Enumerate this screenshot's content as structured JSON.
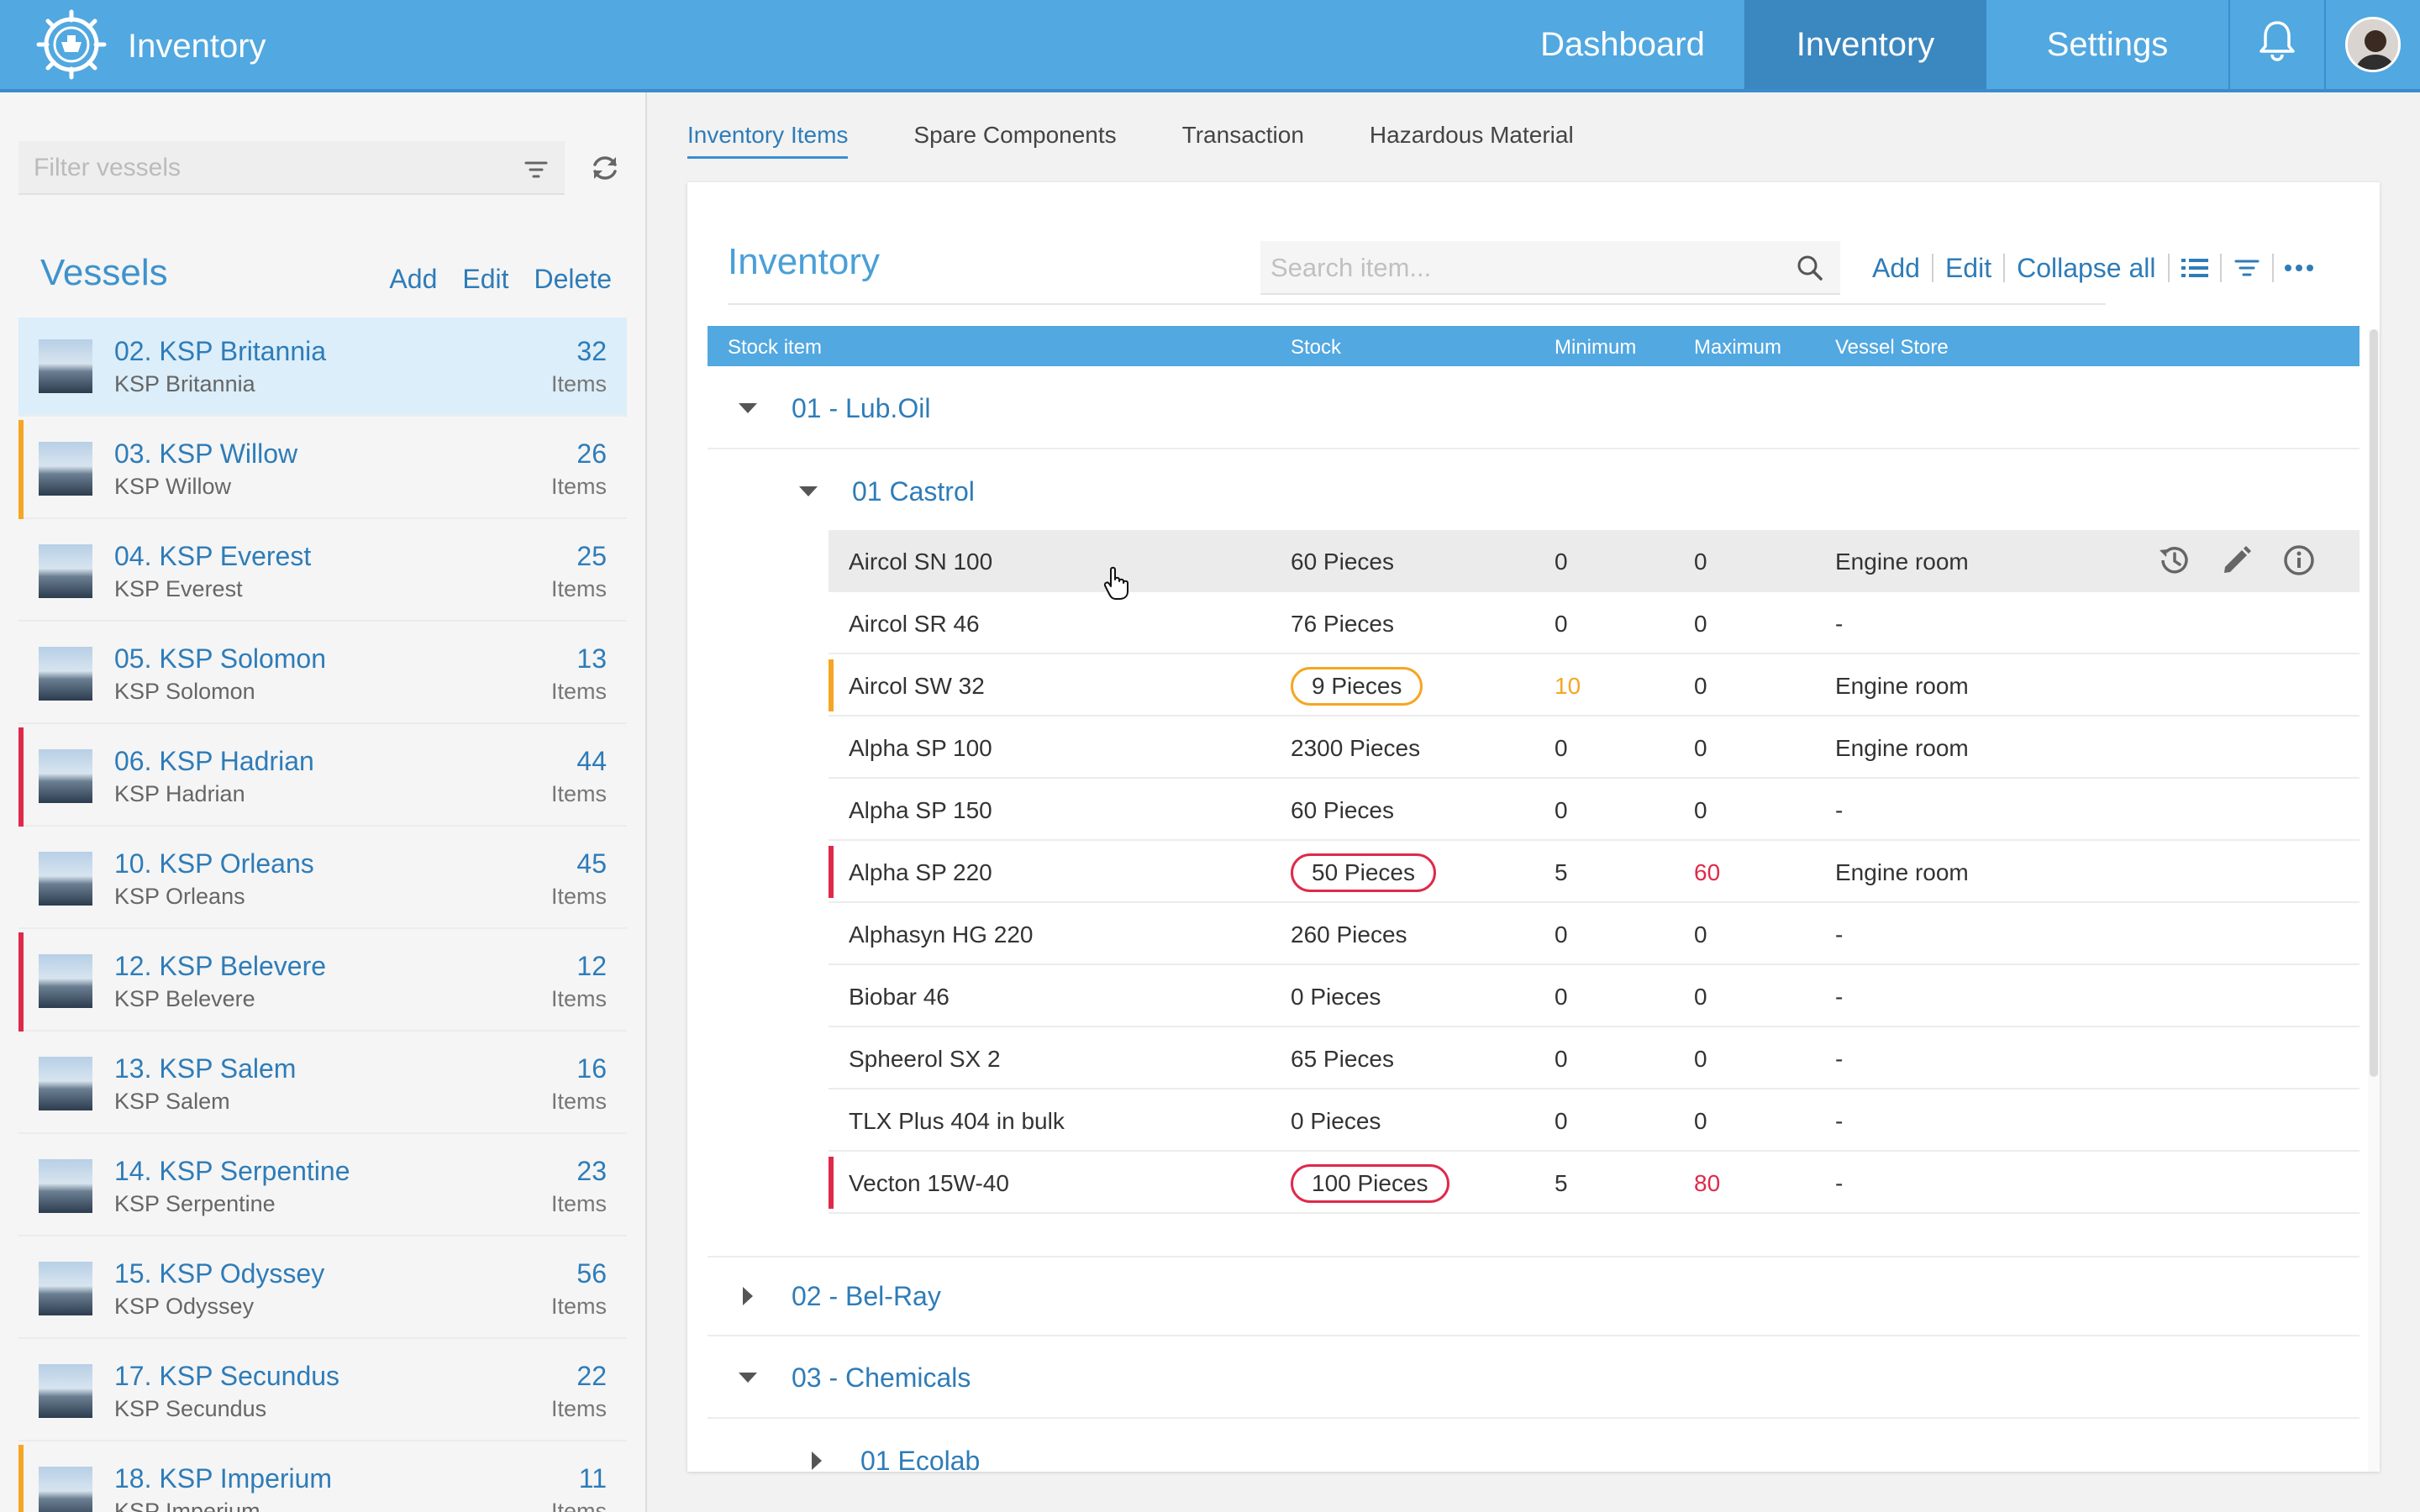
{
  "app": {
    "title": "Inventory"
  },
  "nav": {
    "dashboard": "Dashboard",
    "inventory": "Inventory",
    "settings": "Settings"
  },
  "sidebar": {
    "filter_placeholder": "Filter vessels",
    "title": "Vessels",
    "actions": {
      "add": "Add",
      "edit": "Edit",
      "delete": "Delete"
    },
    "vessels": [
      {
        "name": "02. KSP Britannia",
        "sub": "KSP Britannia",
        "count": "32",
        "unit": "Items",
        "flag": "",
        "selected": true
      },
      {
        "name": "03. KSP Willow",
        "sub": "KSP Willow",
        "count": "26",
        "unit": "Items",
        "flag": "#f5a623"
      },
      {
        "name": "04. KSP Everest",
        "sub": "KSP Everest",
        "count": "25",
        "unit": "Items",
        "flag": ""
      },
      {
        "name": "05. KSP Solomon",
        "sub": "KSP Solomon",
        "count": "13",
        "unit": "Items",
        "flag": ""
      },
      {
        "name": "06. KSP Hadrian",
        "sub": "KSP Hadrian",
        "count": "44",
        "unit": "Items",
        "flag": "#e0294a"
      },
      {
        "name": "10. KSP Orleans",
        "sub": "KSP Orleans",
        "count": "45",
        "unit": "Items",
        "flag": ""
      },
      {
        "name": "12. KSP Belevere",
        "sub": "KSP Belevere",
        "count": "12",
        "unit": "Items",
        "flag": "#e0294a"
      },
      {
        "name": "13. KSP Salem",
        "sub": "KSP Salem",
        "count": "16",
        "unit": "Items",
        "flag": ""
      },
      {
        "name": "14. KSP Serpentine",
        "sub": "KSP Serpentine",
        "count": "23",
        "unit": "Items",
        "flag": ""
      },
      {
        "name": "15. KSP Odyssey",
        "sub": "KSP Odyssey",
        "count": "56",
        "unit": "Items",
        "flag": ""
      },
      {
        "name": "17. KSP Secundus",
        "sub": "KSP Secundus",
        "count": "22",
        "unit": "Items",
        "flag": ""
      },
      {
        "name": "18. KSP Imperium",
        "sub": "KSP Imperium",
        "count": "11",
        "unit": "Items",
        "flag": "#f5a623"
      }
    ]
  },
  "tabs": [
    "Inventory Items",
    "Spare Components",
    "Transaction",
    "Hazardous Material"
  ],
  "main": {
    "title": "Inventory",
    "search_placeholder": "Search item...",
    "actions": {
      "add": "Add",
      "edit": "Edit",
      "collapse": "Collapse all"
    },
    "columns": {
      "stock_item": "Stock item",
      "stock": "Stock",
      "minimum": "Minimum",
      "maximum": "Maximum",
      "store": "Vessel Store"
    },
    "groups": {
      "g1": "01 - Lub.Oil",
      "g1_sub": "01 Castrol",
      "g2": "02 - Bel-Ray",
      "g3": "03 - Chemicals",
      "g3_sub": "01 Ecolab"
    },
    "rows": [
      {
        "name": "Aircol SN 100",
        "stock": "60 Pieces",
        "min": "0",
        "max": "0",
        "store": "Engine room",
        "status": "hover"
      },
      {
        "name": "Aircol SR 46",
        "stock": "76 Pieces",
        "min": "0",
        "max": "0",
        "store": "-",
        "status": ""
      },
      {
        "name": "Aircol SW 32",
        "stock": "9 Pieces",
        "min": "10",
        "max": "0",
        "store": "Engine room",
        "status": "warning"
      },
      {
        "name": "Alpha SP 100",
        "stock": "2300 Pieces",
        "min": "0",
        "max": "0",
        "store": "Engine room",
        "status": ""
      },
      {
        "name": "Alpha SP 150",
        "stock": "60 Pieces",
        "min": "0",
        "max": "0",
        "store": "-",
        "status": ""
      },
      {
        "name": "Alpha SP 220",
        "stock": "50 Pieces",
        "min": "5",
        "max": "60",
        "store": "Engine room",
        "status": "danger"
      },
      {
        "name": "Alphasyn HG 220",
        "stock": "260 Pieces",
        "min": "0",
        "max": "0",
        "store": "-",
        "status": ""
      },
      {
        "name": "Biobar 46",
        "stock": "0 Pieces",
        "min": "0",
        "max": "0",
        "store": "-",
        "status": ""
      },
      {
        "name": "Spheerol SX 2",
        "stock": "65 Pieces",
        "min": "0",
        "max": "0",
        "store": "-",
        "status": ""
      },
      {
        "name": "TLX Plus 404 in bulk",
        "stock": "0 Pieces",
        "min": "0",
        "max": "0",
        "store": "-",
        "status": ""
      },
      {
        "name": "Vecton 15W-40",
        "stock": "100 Pieces",
        "min": "5",
        "max": "80",
        "store": "-",
        "status": "danger"
      }
    ]
  },
  "colors": {
    "primary": "#52a8e0",
    "link": "#2e7cb8",
    "warning": "#f5a623",
    "danger": "#e0294a"
  },
  "icons": [
    "ship-wheel-logo-icon",
    "bell-icon",
    "filter-icon",
    "refresh-icon",
    "search-icon",
    "list-icon",
    "more-icon",
    "history-icon",
    "edit-pencil-icon",
    "info-icon",
    "caret-down-icon",
    "caret-right-icon"
  ]
}
